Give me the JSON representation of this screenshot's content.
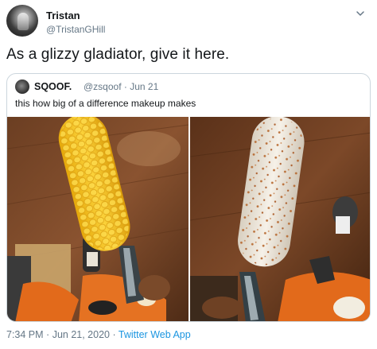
{
  "author": {
    "display_name": "Tristan",
    "handle": "@TristanGHill",
    "avatar_icon": "avatar-icon"
  },
  "tweet": {
    "text": "As a glizzy gladiator, give it here."
  },
  "quoted_tweet": {
    "display_name": "SQOOF.",
    "handle": "@zsqoof",
    "separator": "·",
    "date": "Jun 21",
    "text": "this how big of a difference makeup makes"
  },
  "footer": {
    "time": "7:34 PM",
    "separator1": "·",
    "date": "Jun 21, 2020",
    "separator2": "·",
    "source": "Twitter Web App"
  },
  "colors": {
    "text": "#14171a",
    "secondary": "#657786",
    "link": "#1b95e0",
    "border": "#ccd6dd"
  }
}
